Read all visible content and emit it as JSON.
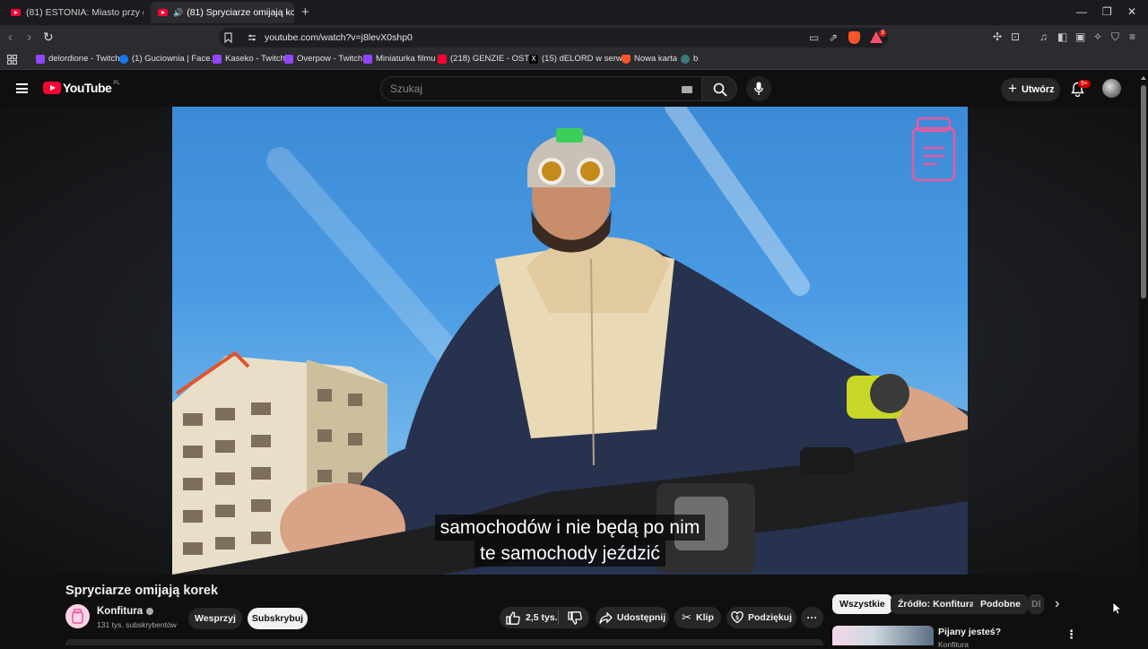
{
  "browser": {
    "tabs": [
      {
        "title": "(81) ESTONIA: Miasto przy granicy z R",
        "active": false
      },
      {
        "title": "(81) Spryciarze omijają korek",
        "active": true
      }
    ],
    "new_tab": "+",
    "window_controls": {
      "minimize": "—",
      "restore": "❐",
      "close": "✕"
    },
    "url": "youtube.com/watch?v=j8levX0shp0",
    "shield_count": "3",
    "bookmarks": [
      {
        "label": "delordione - Twitch",
        "icon": "twitch-icon",
        "color": "#9146ff"
      },
      {
        "label": "(1) Guciownia | Face...",
        "icon": "facebook-icon",
        "color": "#1877f2"
      },
      {
        "label": "Kaseko - Twitch",
        "icon": "twitch-icon",
        "color": "#9146ff"
      },
      {
        "label": "Overpow - Twitch",
        "icon": "twitch-icon",
        "color": "#9146ff"
      },
      {
        "label": "Miniaturka filmu",
        "icon": "twitch-icon",
        "color": "#9146ff"
      },
      {
        "label": "(218) GENZIE - OST...",
        "icon": "youtube-icon",
        "color": "#ff0033"
      },
      {
        "label": "(15) dELORD w serw...",
        "icon": "x-icon",
        "color": "#000000"
      },
      {
        "label": "Nowa karta",
        "icon": "brave-icon",
        "color": "#fb542b"
      },
      {
        "label": "b",
        "icon": "globe-icon",
        "color": "#3a7a7a"
      }
    ]
  },
  "youtube": {
    "logo_text": "YouTube",
    "country_code": "PL",
    "search_placeholder": "Szukaj",
    "create_label": "Utwórz",
    "notification_badge": "9+"
  },
  "video": {
    "subtitle_line1": "samochodów i nie będą po nim",
    "subtitle_line2": "te samochody jeździć",
    "title": "Spryciarze omijają korek",
    "channel": "Konfitura",
    "subscribers": "131 tys. subskrybentów",
    "support_label": "Wesprzyj",
    "subscribe_label": "Subskrybuj",
    "likes": "2,5 tys.",
    "share_label": "Udostępnij",
    "clip_label": "Klip",
    "thanks_label": "Podziękuj",
    "more_label": "···"
  },
  "sidebar": {
    "chips": [
      {
        "label": "Wszystkie",
        "active": true
      },
      {
        "label": "Źródło: Konfitura",
        "active": false
      },
      {
        "label": "Podobne",
        "active": false
      },
      {
        "label": "Dl",
        "active": false
      }
    ],
    "related": [
      {
        "title": "Pijany jesteś?",
        "channel": "Konfitura"
      }
    ]
  },
  "colors": {
    "youtube_red": "#ff0033",
    "background": "#0f0f0f",
    "pill_bg": "#272727"
  }
}
